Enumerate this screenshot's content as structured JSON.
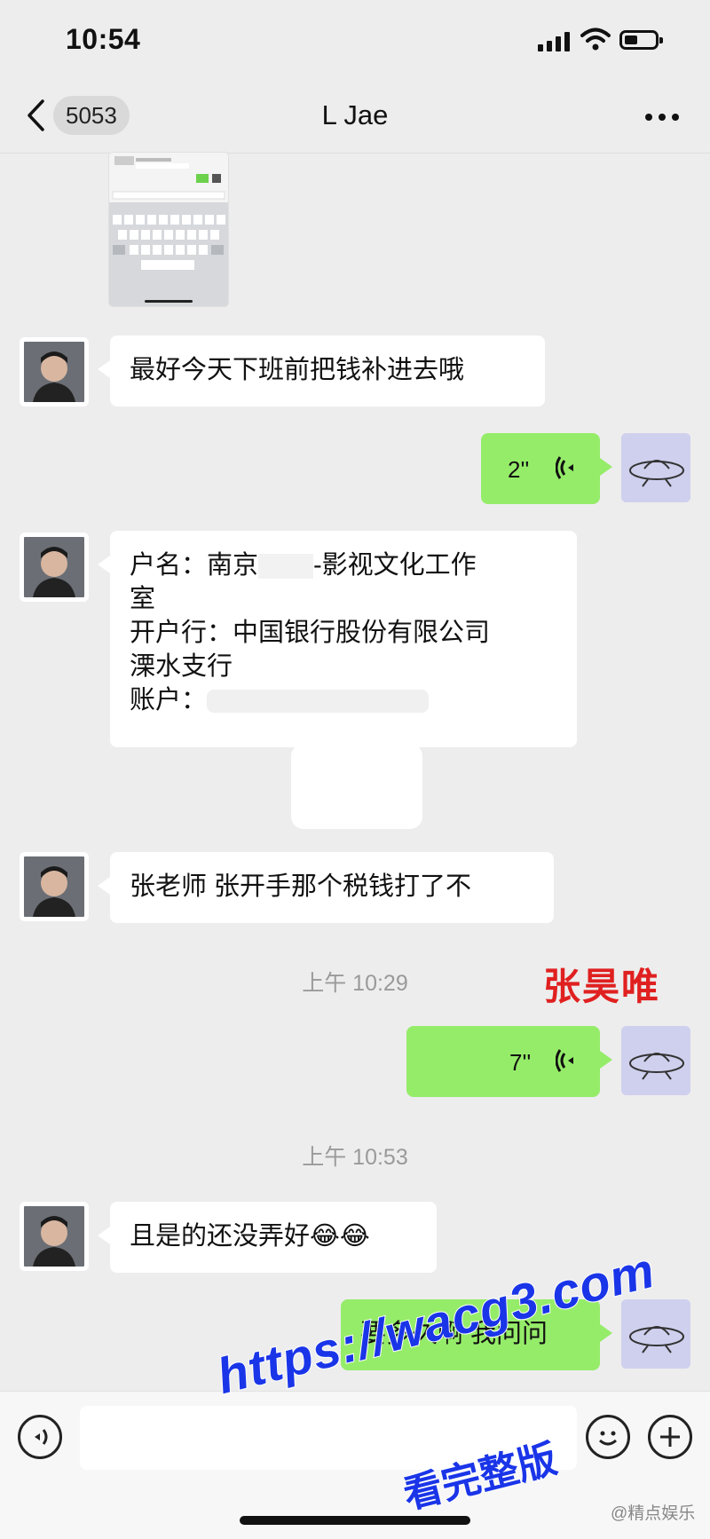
{
  "status_bar": {
    "time": "10:54"
  },
  "nav": {
    "back_count": "5053",
    "title": "L Jae"
  },
  "messages": [
    {
      "type": "image",
      "sender": "contact"
    },
    {
      "type": "text",
      "sender": "contact",
      "text": "最好今天下班前把钱补进去哦"
    },
    {
      "type": "voice",
      "sender": "me",
      "duration": "2''"
    },
    {
      "type": "text",
      "sender": "contact",
      "lines": [
        "户名：南京",
        "-影视文化工作",
        "室",
        "开户行：中国银行股份有限公司",
        "溧水支行",
        "账户："
      ]
    },
    {
      "type": "text",
      "sender": "contact",
      "text": "张老师 张开手那个税钱打了不"
    },
    {
      "type": "timestamp",
      "text": "上午 10:29"
    },
    {
      "type": "voice",
      "sender": "me",
      "duration": "7''"
    },
    {
      "type": "timestamp",
      "text": "上午 10:53"
    },
    {
      "type": "text",
      "sender": "contact",
      "text": "且是的还没弄好😂😂"
    },
    {
      "type": "text",
      "sender": "me",
      "text": "要多久啊 我问问"
    }
  ],
  "overlay": {
    "name_label": "张昊唯",
    "promo_url": "https://wacg3.com",
    "promo_text": "看完整版",
    "source_mark": "@精点娱乐"
  },
  "input_bar": {
    "placeholder": ""
  },
  "colors": {
    "background": "#ededed",
    "bubble_out": "#95ec69",
    "bubble_in": "#ffffff",
    "accent_red": "#e02020",
    "promo_blue": "#1a35e8"
  },
  "icons": [
    "back-chevron-icon",
    "more-dots-icon",
    "voice-wave-icon",
    "voice-toggle-icon",
    "emoji-icon",
    "plus-icon",
    "signal-icon",
    "wifi-icon",
    "battery-icon"
  ]
}
